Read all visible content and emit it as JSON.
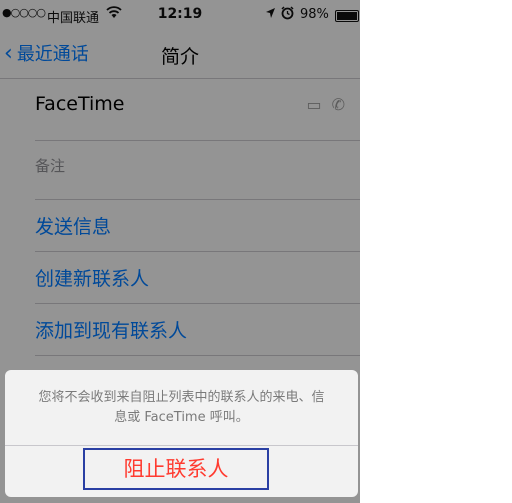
{
  "status_bar": {
    "signal": "●○○○○",
    "carrier": "中国联通",
    "time": "12:19",
    "battery": "98%"
  },
  "nav": {
    "back_label": "最近通话",
    "title": "简介"
  },
  "rows": {
    "facetime": "FaceTime",
    "notes": "备注",
    "send_message": "发送信息",
    "create_contact": "创建新联系人",
    "add_to_existing": "添加到现有联系人"
  },
  "action_sheet": {
    "message_line1": "您将不会收到来自阻止列表中的联系人的来电、信",
    "message_line2": "息或 FaceTime 呼叫。",
    "block_button": "阻止联系人"
  },
  "colors": {
    "accent": "#007aff",
    "destructive": "#ff3b30",
    "highlight_border": "#2a3fa3"
  }
}
